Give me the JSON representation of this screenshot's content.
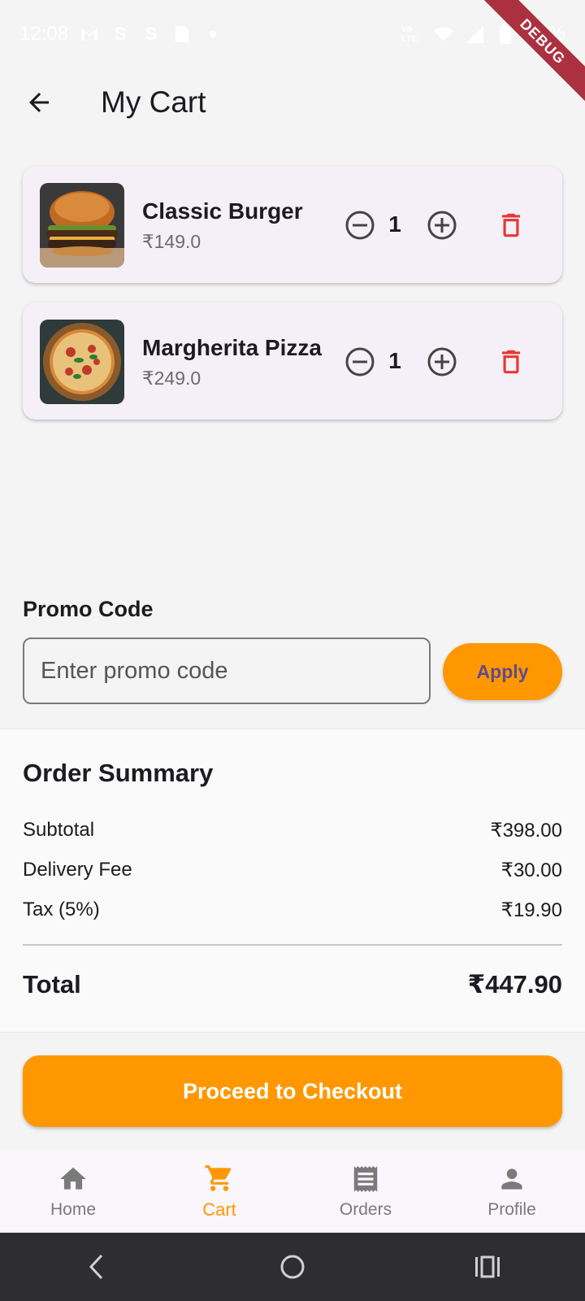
{
  "status_bar": {
    "time": "12:08",
    "battery": "62%",
    "colors": {
      "text": "#ffffff"
    }
  },
  "debug_banner": "DEBUG",
  "app_bar": {
    "title": "My Cart",
    "back_icon": "arrow-back-icon"
  },
  "cart": {
    "items": [
      {
        "name": "Classic Burger",
        "price": "₹149.0",
        "quantity": "1",
        "image": "burger-photo"
      },
      {
        "name": "Margherita Pizza",
        "price": "₹249.0",
        "quantity": "1",
        "image": "pizza-photo"
      }
    ]
  },
  "promo": {
    "heading": "Promo Code",
    "placeholder": "Enter promo code",
    "value": "",
    "apply_label": "Apply"
  },
  "summary": {
    "title": "Order Summary",
    "rows": [
      {
        "label": "Subtotal",
        "value": "₹398.00"
      },
      {
        "label": "Delivery Fee",
        "value": "₹30.00"
      },
      {
        "label": "Tax (5%)",
        "value": "₹19.90"
      }
    ],
    "total_label": "Total",
    "total_value": "₹447.90"
  },
  "checkout": {
    "label": "Proceed to Checkout"
  },
  "bottom_nav": {
    "items": [
      {
        "label": "Home",
        "icon": "home-icon",
        "active": false
      },
      {
        "label": "Cart",
        "icon": "cart-icon",
        "active": true
      },
      {
        "label": "Orders",
        "icon": "receipt-icon",
        "active": false
      },
      {
        "label": "Profile",
        "icon": "person-icon",
        "active": false
      }
    ]
  },
  "colors": {
    "accent": "#ff9800",
    "delete": "#e53935",
    "background": "#f4f4f4",
    "card": "#f5f0f8",
    "apply_text": "#5f4a8b",
    "nav_inactive": "#7a7a7a"
  }
}
